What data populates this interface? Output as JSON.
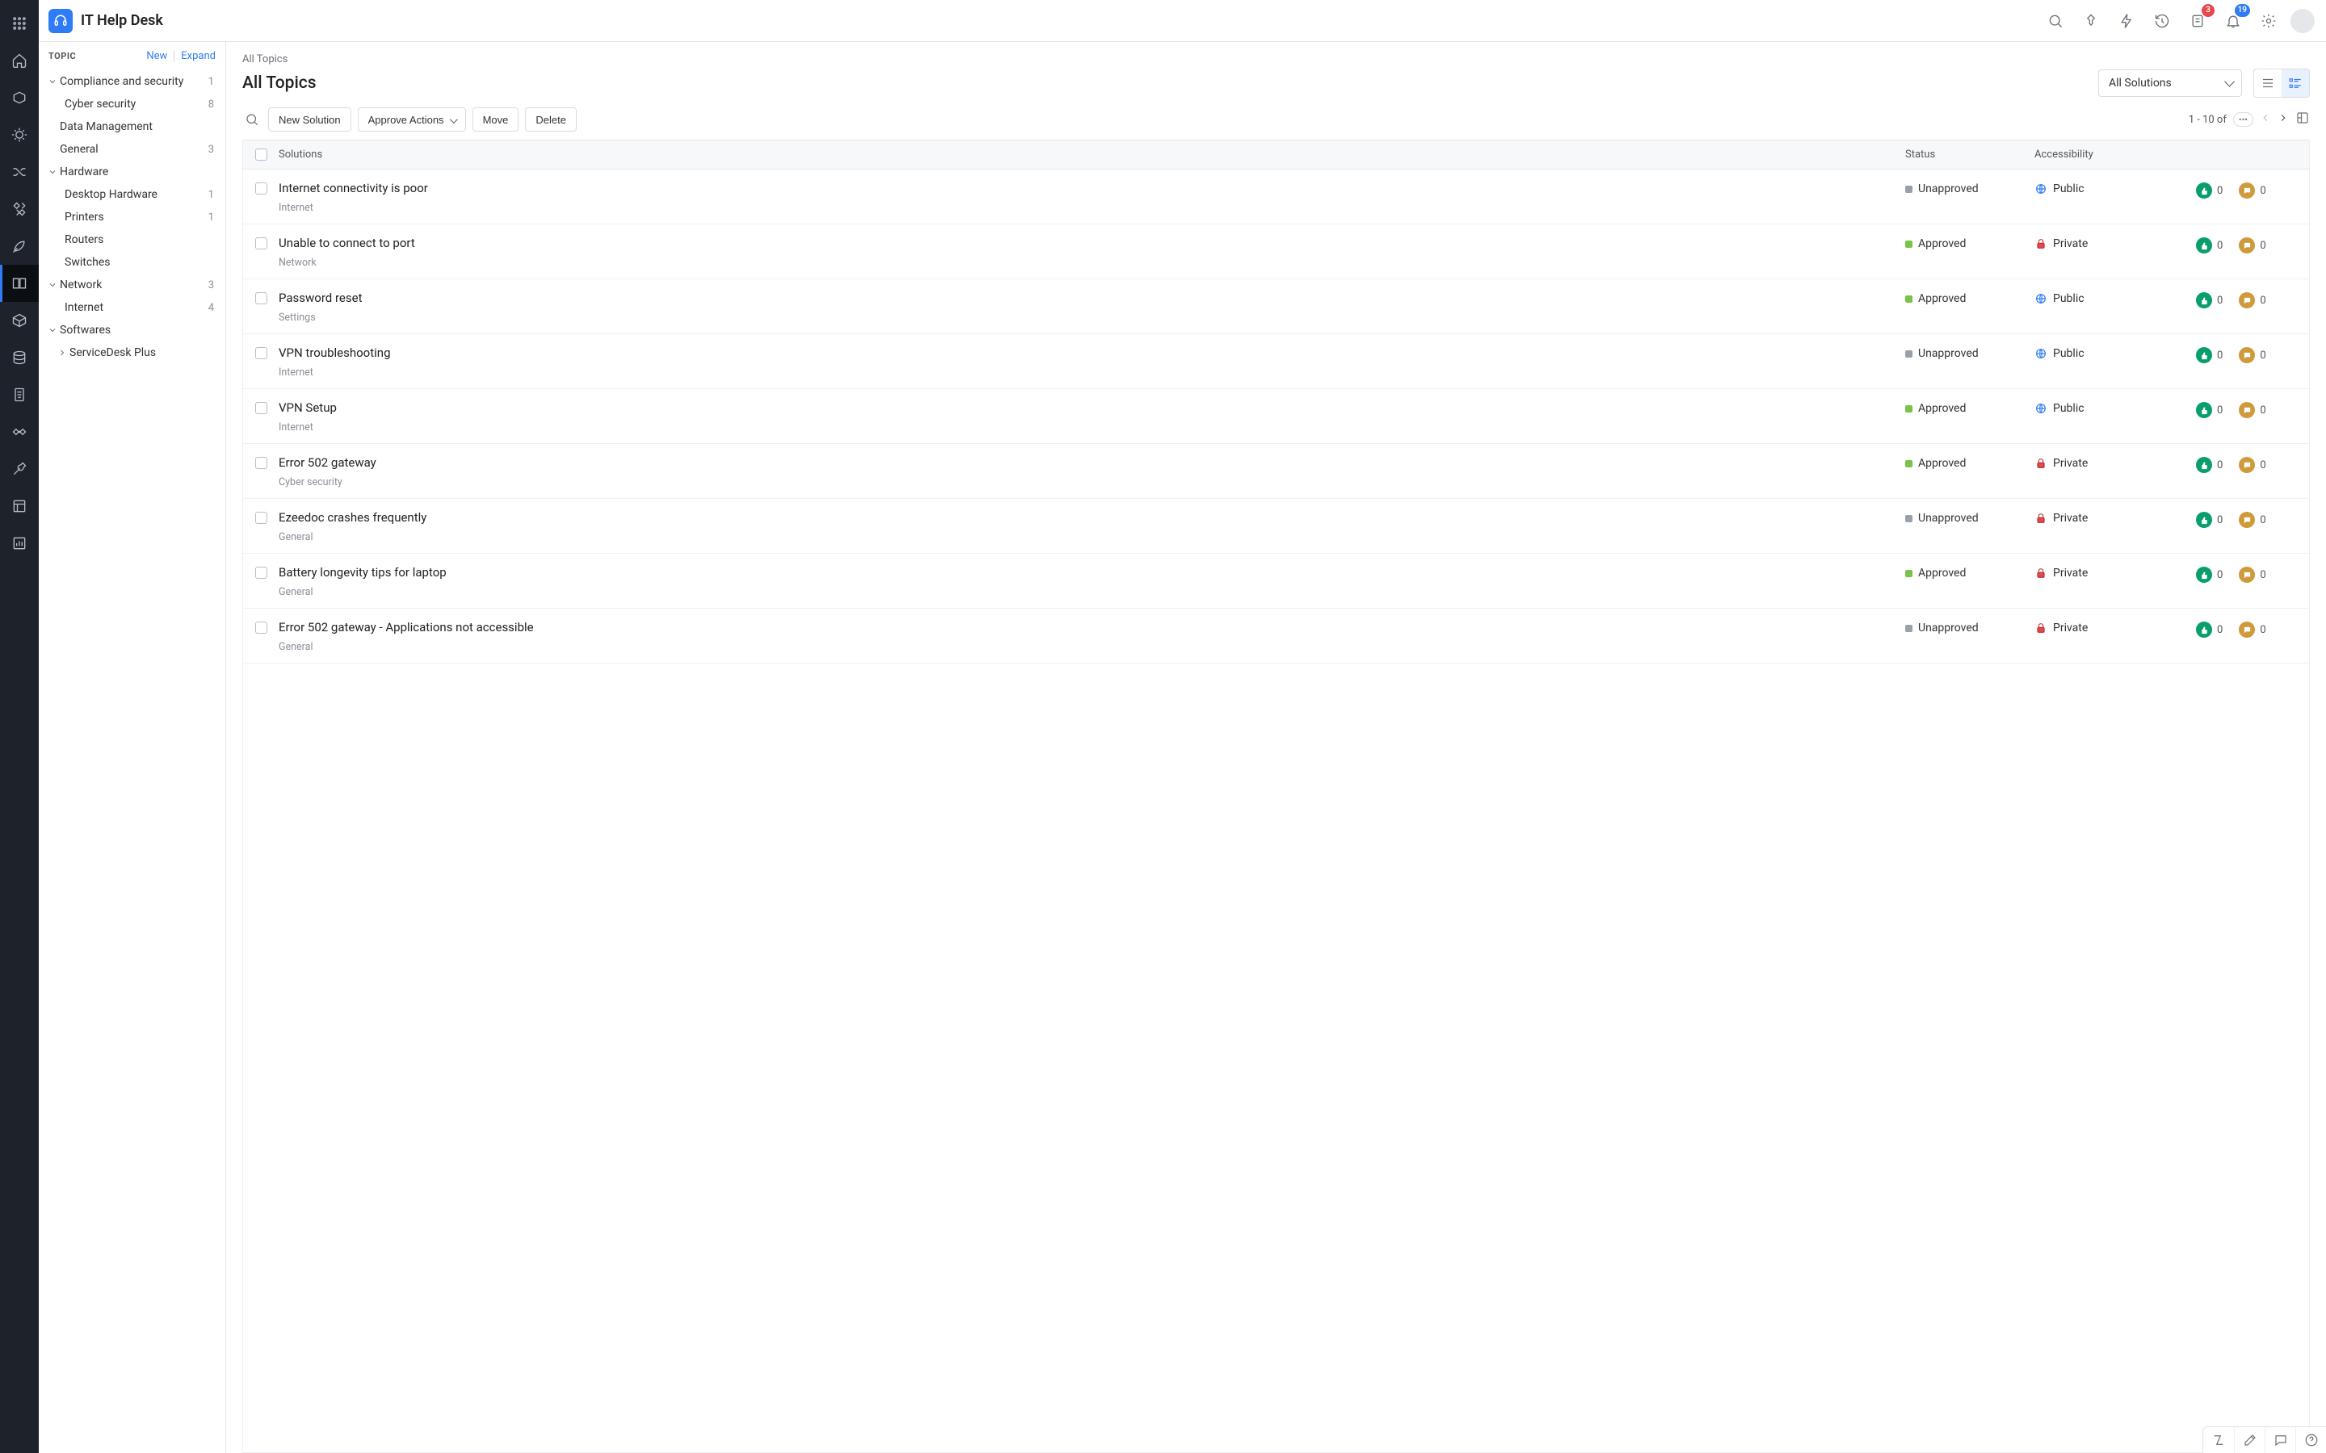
{
  "header": {
    "app_title": "IT Help Desk",
    "pending_badge": "3",
    "notif_badge": "19"
  },
  "topic_panel": {
    "heading": "TOPIC",
    "new_label": "New",
    "expand_label": "Expand",
    "tree": [
      {
        "label": "Compliance and security",
        "count": "1",
        "expandable": true,
        "expanded": true,
        "level": 0
      },
      {
        "label": "Cyber security",
        "count": "8",
        "expandable": false,
        "level": 1
      },
      {
        "label": "Data Management",
        "count": "",
        "expandable": false,
        "level": 0,
        "leaf": true
      },
      {
        "label": "General",
        "count": "3",
        "expandable": false,
        "level": 0,
        "leaf": true
      },
      {
        "label": "Hardware",
        "count": "",
        "expandable": true,
        "expanded": true,
        "level": 0
      },
      {
        "label": "Desktop Hardware",
        "count": "1",
        "expandable": false,
        "level": 1
      },
      {
        "label": "Printers",
        "count": "1",
        "expandable": false,
        "level": 1
      },
      {
        "label": "Routers",
        "count": "",
        "expandable": false,
        "level": 1
      },
      {
        "label": "Switches",
        "count": "",
        "expandable": false,
        "level": 1
      },
      {
        "label": "Network",
        "count": "3",
        "expandable": true,
        "expanded": true,
        "level": 0
      },
      {
        "label": "Internet",
        "count": "4",
        "expandable": false,
        "level": 1
      },
      {
        "label": "Softwares",
        "count": "",
        "expandable": true,
        "expanded": true,
        "level": 0
      },
      {
        "label": "ServiceDesk Plus",
        "count": "",
        "expandable": true,
        "expanded": false,
        "level": 1,
        "has_caret": true
      }
    ]
  },
  "content": {
    "breadcrumb": "All Topics",
    "page_title": "All Topics",
    "filter_selected": "All Solutions",
    "toolbar": {
      "new_solution": "New Solution",
      "approve_actions": "Approve Actions",
      "move": "Move",
      "delete": "Delete"
    },
    "pager_text": "1 - 10 of",
    "columns": {
      "solutions": "Solutions",
      "status": "Status",
      "accessibility": "Accessibility"
    },
    "status_labels": {
      "approved": "Approved",
      "unapproved": "Unapproved"
    },
    "access_labels": {
      "public": "Public",
      "private": "Private"
    },
    "rows": [
      {
        "title": "Internet connectivity is poor",
        "category": "Internet",
        "status": "unapproved",
        "access": "public",
        "likes": "0",
        "comments": "0"
      },
      {
        "title": "Unable to connect to port",
        "category": "Network",
        "status": "approved",
        "access": "private",
        "likes": "0",
        "comments": "0"
      },
      {
        "title": "Password reset",
        "category": "Settings",
        "status": "approved",
        "access": "public",
        "likes": "0",
        "comments": "0"
      },
      {
        "title": "VPN troubleshooting",
        "category": "Internet",
        "status": "unapproved",
        "access": "public",
        "likes": "0",
        "comments": "0"
      },
      {
        "title": "VPN Setup",
        "category": "Internet",
        "status": "approved",
        "access": "public",
        "likes": "0",
        "comments": "0"
      },
      {
        "title": "Error 502 gateway",
        "category": "Cyber security",
        "status": "approved",
        "access": "private",
        "likes": "0",
        "comments": "0"
      },
      {
        "title": "Ezeedoc crashes frequently",
        "category": "General",
        "status": "unapproved",
        "access": "private",
        "likes": "0",
        "comments": "0"
      },
      {
        "title": "Battery longevity tips for laptop",
        "category": "General",
        "status": "approved",
        "access": "private",
        "likes": "0",
        "comments": "0"
      },
      {
        "title": "Error 502 gateway - Applications not accessible",
        "category": "General",
        "status": "unapproved",
        "access": "private",
        "likes": "0",
        "comments": "0"
      }
    ]
  }
}
